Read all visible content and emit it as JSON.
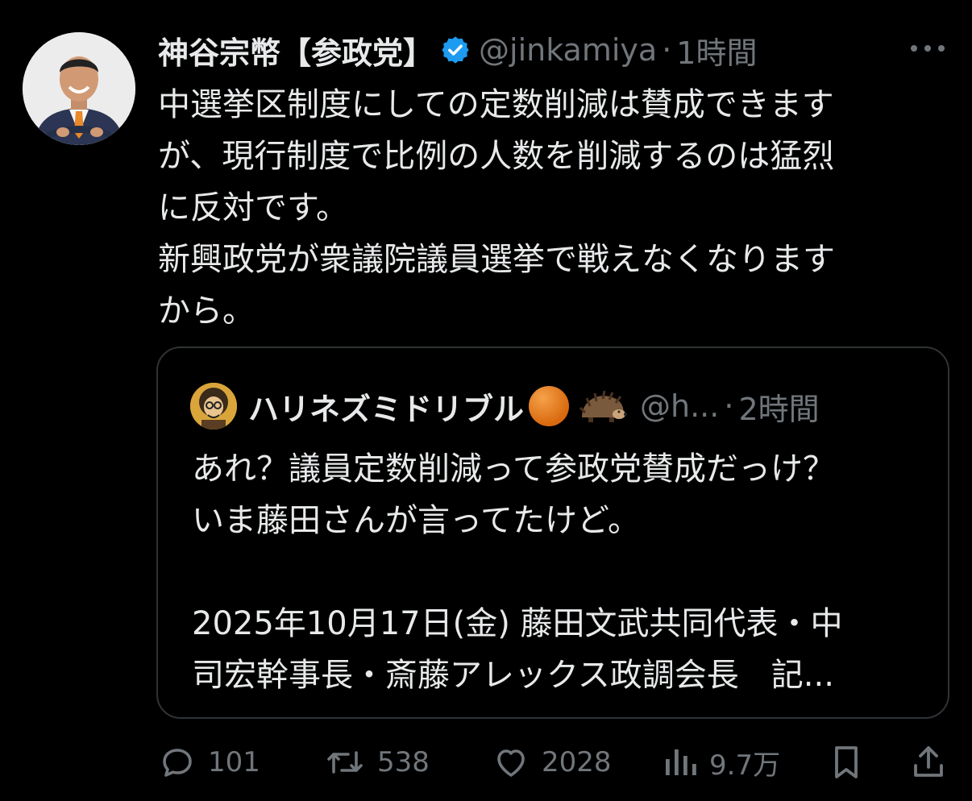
{
  "tweet": {
    "display_name": "神谷宗幣【参政党】",
    "handle": "@jinkamiya",
    "separator": "·",
    "time": "1時間",
    "body_lines": [
      "中選挙区制度にしての定数削減は賛成できます",
      "が、現行制度で比例の人数を削減するのは猛烈",
      "に反対です。",
      "新興政党が衆議院議員選挙で戦えなくなります",
      "から。"
    ]
  },
  "quote": {
    "display_name": "ハリネズミドリブル",
    "handle": "@h...",
    "separator": "·",
    "time": "2時間",
    "body_lines": [
      "あれ？議員定数削減って参政党賛成だっけ？",
      "いま藤田さんが言ってたけど。",
      "",
      "2025年10月17日(金)  藤田文武共同代表・中",
      "司宏幹事長・斎藤アレックス政調会長　記..."
    ]
  },
  "actions": {
    "replies": "101",
    "reposts": "538",
    "likes": "2028",
    "views": "9.7万"
  },
  "icons": {
    "more": "more-icon",
    "verified": "verified-badge-icon",
    "reply": "reply-icon",
    "repost": "repost-icon",
    "like": "heart-icon",
    "views": "views-icon",
    "bookmark": "bookmark-icon",
    "share": "share-icon"
  },
  "colors": {
    "background": "#000000",
    "text": "#e7e9ea",
    "secondary": "#71767b",
    "border": "#2f3336",
    "verified": "#1d9bf0"
  }
}
